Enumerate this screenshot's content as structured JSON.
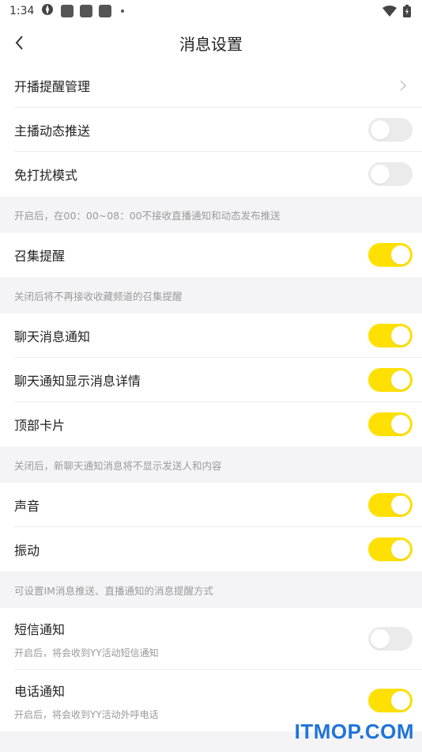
{
  "status_bar": {
    "time": "1:34"
  },
  "nav": {
    "title": "消息设置"
  },
  "rows": {
    "live_reminder": {
      "label": "开播提醒管理"
    },
    "anchor_feed": {
      "label": "主播动态推送",
      "on": false
    },
    "do_not_disturb": {
      "label": "免打扰模式",
      "on": false
    },
    "gather": {
      "label": "召集提醒",
      "on": true
    },
    "chat_notify": {
      "label": "聊天消息通知",
      "on": true
    },
    "chat_detail": {
      "label": "聊天通知显示消息详情",
      "on": true
    },
    "top_card": {
      "label": "顶部卡片",
      "on": true
    },
    "sound": {
      "label": "声音",
      "on": true
    },
    "vibrate": {
      "label": "振动",
      "on": true
    },
    "sms": {
      "label": "短信通知",
      "sub": "开启后，将会收到YY活动短信通知",
      "on": false
    },
    "phone": {
      "label": "电话通知",
      "sub": "开启后，将会收到YY活动外呼电话",
      "on": true
    }
  },
  "notes": {
    "dnd": "开启后，在00：00~08：00不接收直播通知和动态发布推送",
    "gather": "关闭后将不再接收收藏频道的召集提醒",
    "chat": "关闭后，新聊天通知消息将不显示发送人和内容",
    "im": "可设置IM消息推送、直播通知的消息提醒方式"
  },
  "icons": {
    "back": "back-arrow-icon",
    "chevron": "chevron-right-icon",
    "wifi": "wifi-icon",
    "battery": "battery-icon"
  },
  "colors": {
    "toggle_on": "#ffe000",
    "toggle_off": "#ebebeb",
    "watermark": "#1f74d9"
  },
  "watermark": {
    "text": "ITMOP.COM"
  }
}
